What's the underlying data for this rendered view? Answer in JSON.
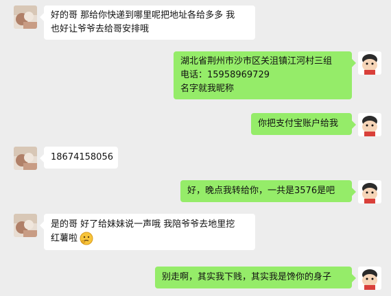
{
  "chat": {
    "messages": [
      {
        "side": "left",
        "lines": [
          "好的哥 那给你快递到哪里呢把地址各给多多 我",
          "也好让爷爷去给哥安排哦"
        ]
      },
      {
        "side": "right",
        "lines": [
          "湖北省荆州市沙市区关沮镇江河村三组",
          "电话：15958969729",
          "名字就我昵称"
        ]
      },
      {
        "side": "right",
        "lines": [
          "你把支付宝账户给我"
        ]
      },
      {
        "side": "left",
        "lines": [
          "18674158056"
        ]
      },
      {
        "side": "right",
        "lines": [
          "好，晚点我转给你，一共是3576是吧"
        ]
      },
      {
        "side": "left",
        "lines": [
          "是的哥 好了给妹妹说一声哦 我陪爷爷去地里挖",
          "红薯啦"
        ],
        "emoji": "thinking-face-emoji"
      },
      {
        "side": "right",
        "lines": [
          "别走啊，其实我下贱，其实我是馋你的身子"
        ]
      }
    ]
  },
  "colors": {
    "background": "#ededed",
    "bubble_self": "#95ec69",
    "bubble_other": "#ffffff"
  },
  "icons": {
    "left_avatar": "photo-avatar",
    "right_avatar": "cartoon-avatar"
  }
}
